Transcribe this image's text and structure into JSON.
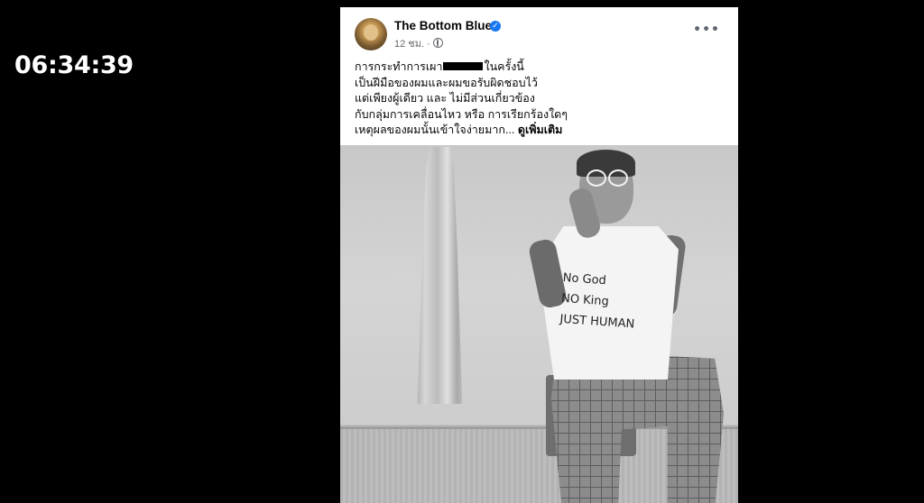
{
  "overlay": {
    "timer": "06:34:39"
  },
  "post": {
    "page_name": "The Bottom Blues",
    "time": "12 ชม.",
    "separator": "·",
    "more_label": "•••",
    "text_lines": {
      "line1_before": "การกระทำการเผา",
      "line1_after": "ในครั้งนี้",
      "line2": "เป็นฝีมือของผมและผมขอรับผิดชอบไว้",
      "line3": "แต่เพียงผู้เดียว และ ไม่มีส่วนเกี่ยวข้อง",
      "line4": "กับกลุ่มการเคลื่อนไหว หรือ การเรียกร้องใดๆ",
      "line5": "เหตุผลของผมนั้นเข้าใจง่ายมาก..."
    },
    "see_more": "ดูเพิ่มเติม",
    "photo": {
      "shirt_text": [
        "No God",
        "NO King",
        "JUST HUMAN"
      ]
    }
  },
  "colors": {
    "verified": "#1877f2",
    "meta": "#65676b"
  }
}
